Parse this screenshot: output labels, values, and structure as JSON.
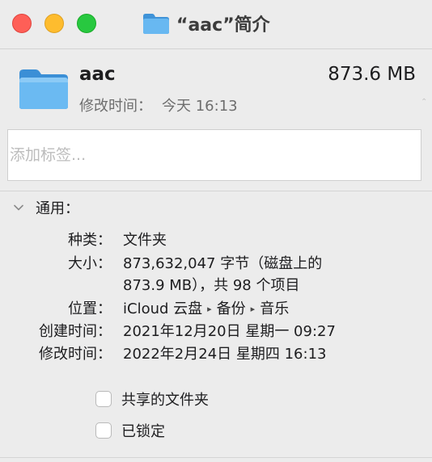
{
  "window": {
    "title": "“aac”简介",
    "colors": {
      "close": "#fe5f57",
      "minimize": "#febc2e",
      "zoom": "#28c840",
      "folder": "#5fb2ef"
    }
  },
  "header": {
    "icon": "folder-icon",
    "name": "aac",
    "size": "873.6 MB",
    "modified_label": "修改时间：",
    "modified_value": "今天 16:13"
  },
  "tags": {
    "placeholder": "添加标签..."
  },
  "general": {
    "title": "通用：",
    "rows": [
      {
        "label": "种类：",
        "value": "文件夹"
      },
      {
        "label": "大小：",
        "value": "873,632,047 字节（磁盘上的",
        "value2": "873.9 MB），共 98 个项目"
      },
      {
        "label": "位置：",
        "path": [
          "iCloud 云盘",
          "备份",
          "音乐"
        ]
      },
      {
        "label": "创建时间：",
        "value": "2021年12月20日 星期一 09:27"
      },
      {
        "label": "修改时间：",
        "value": "2022年2月24日 星期四 16:13"
      }
    ],
    "path_separator": "▸"
  },
  "options": {
    "shared_folder": {
      "label": "共享的文件夹",
      "checked": false
    },
    "locked": {
      "label": "已锁定",
      "checked": false
    }
  }
}
